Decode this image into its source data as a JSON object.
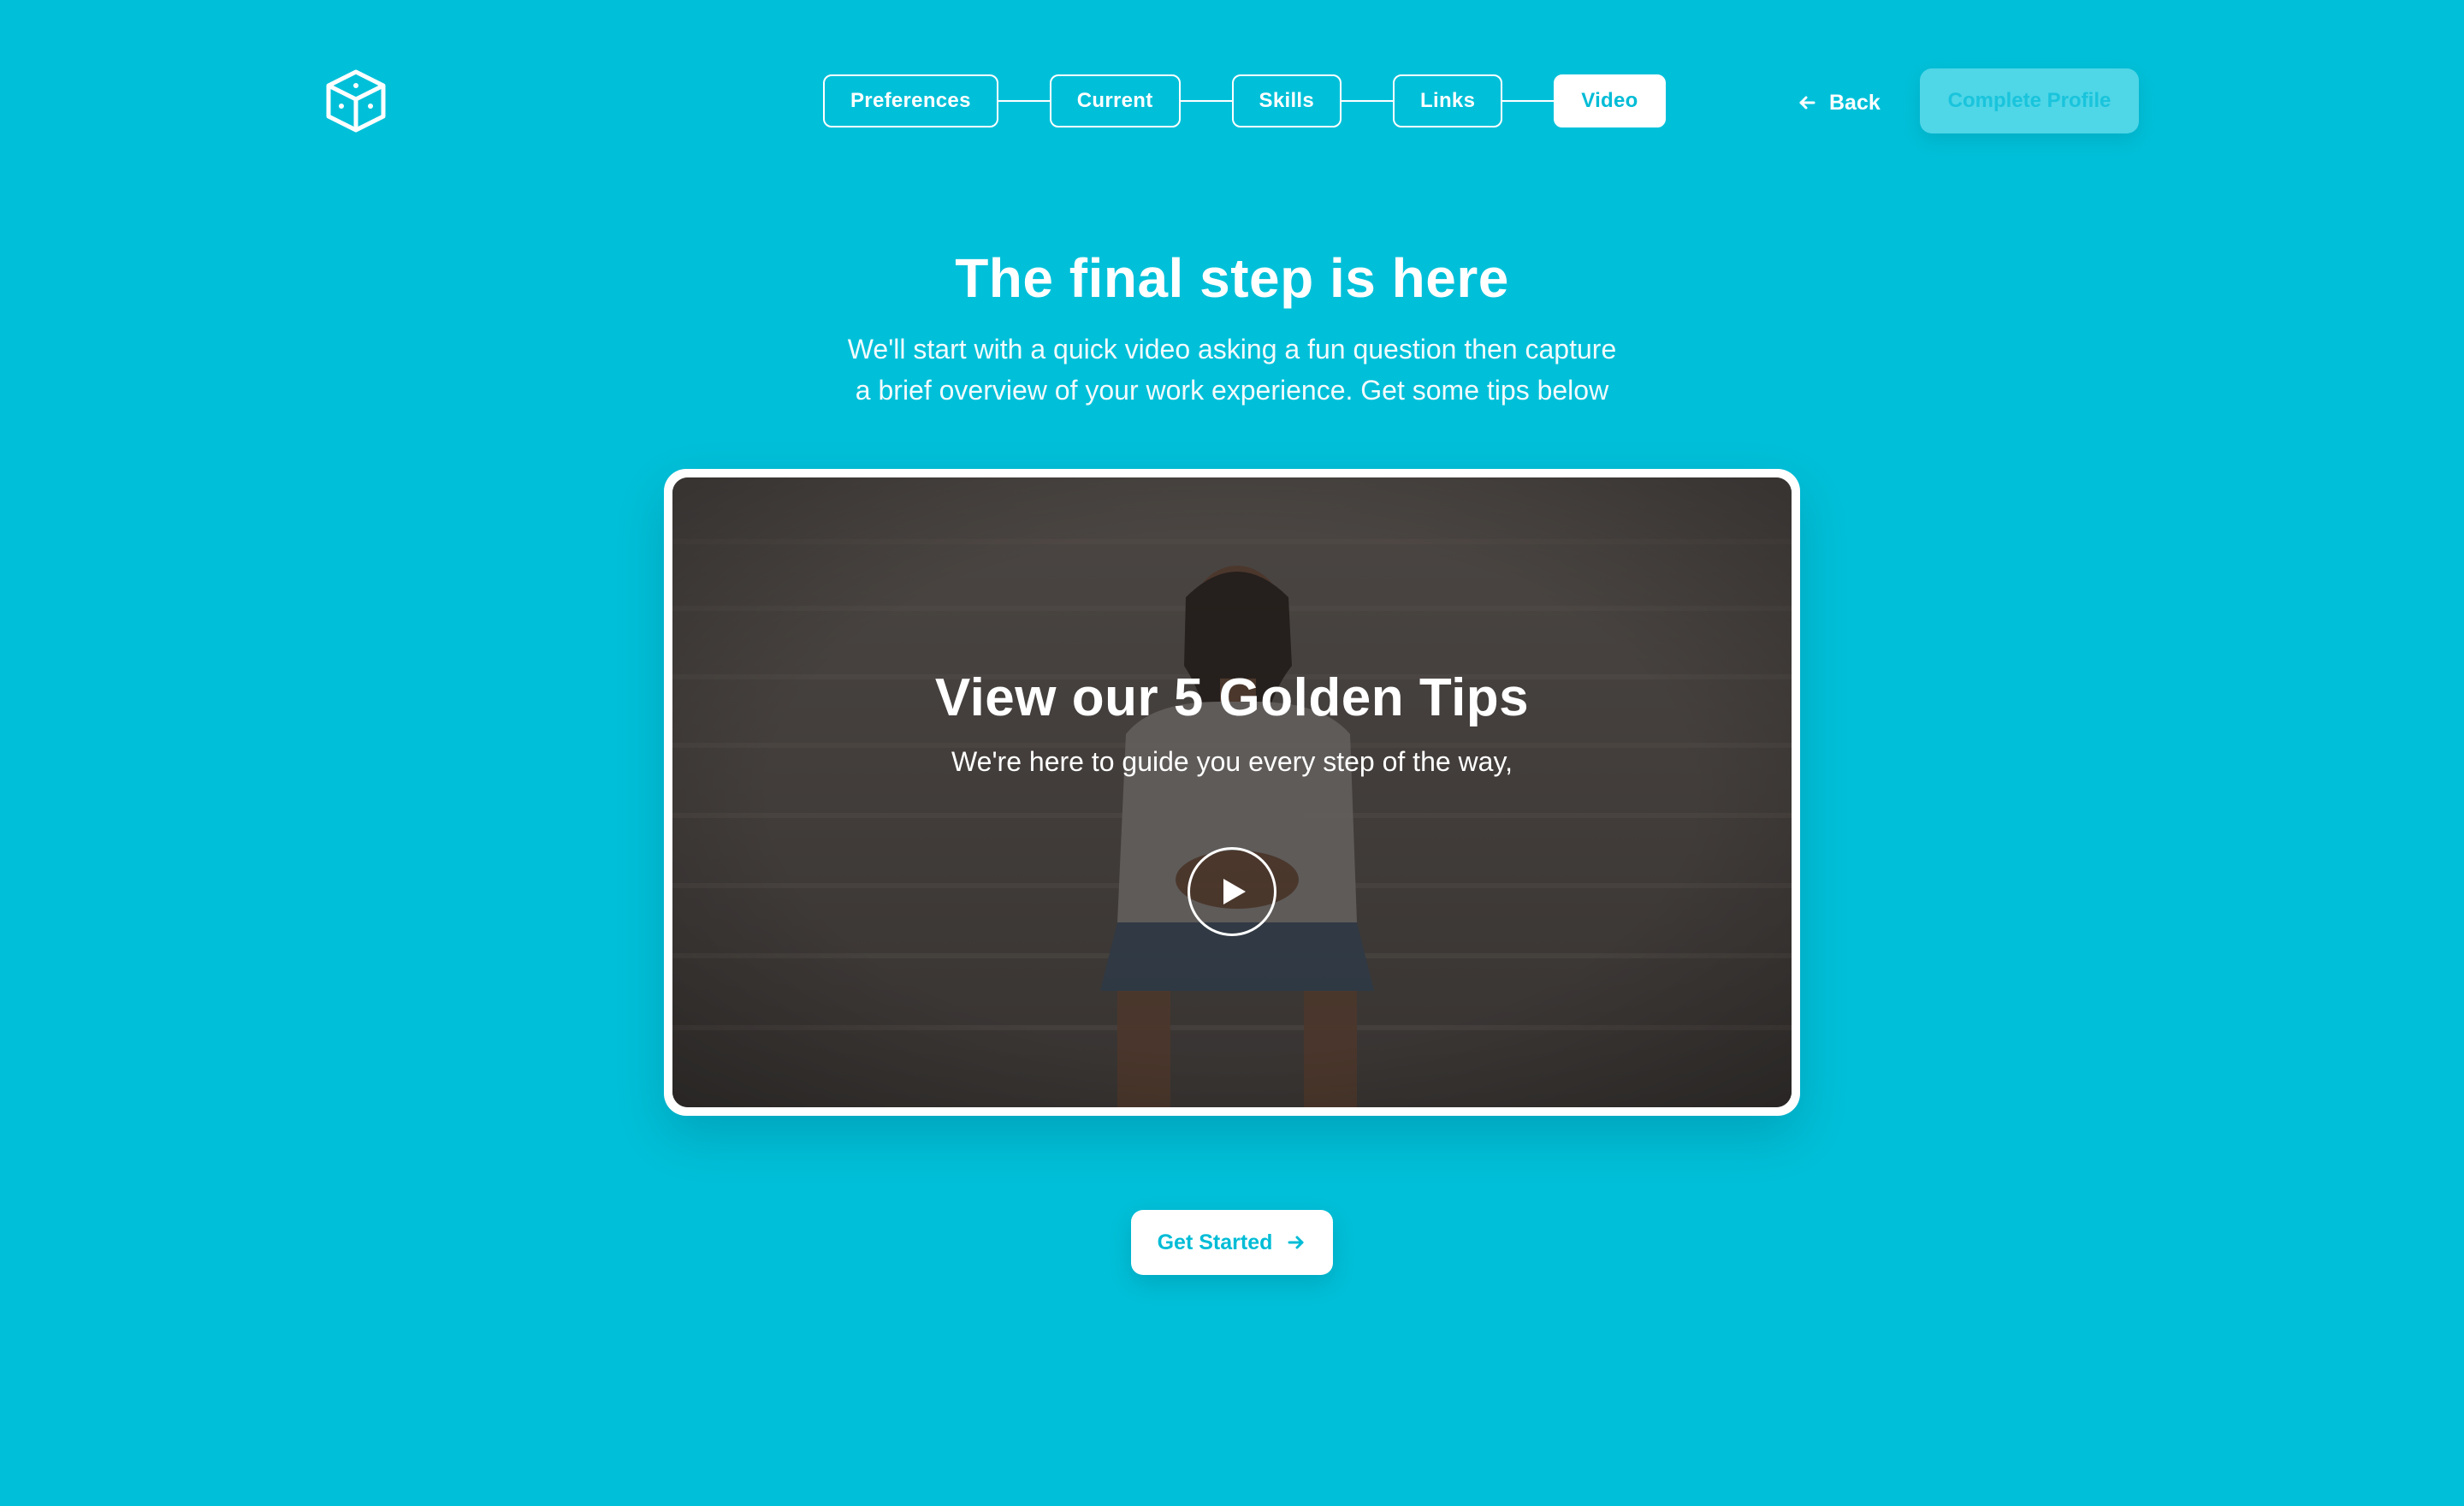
{
  "header": {
    "logo_icon": "cube-icon",
    "steps": [
      {
        "label": "Preferences",
        "active": false
      },
      {
        "label": "Current",
        "active": false
      },
      {
        "label": "Skills",
        "active": false
      },
      {
        "label": "Links",
        "active": false
      },
      {
        "label": "Video",
        "active": true
      }
    ],
    "back_label": "Back",
    "back_icon": "arrow-left-icon",
    "complete_label": "Complete Profile"
  },
  "main": {
    "title": "The final step is here",
    "subtitle_line1": "We'll start with a quick video asking a fun question then capture",
    "subtitle_line2": "a brief overview of your work experience. Get some tips below"
  },
  "video": {
    "title": "View our 5 Golden Tips",
    "subtitle": "We're here to guide you every step of the way,",
    "play_icon": "play-icon"
  },
  "cta": {
    "label": "Get Started",
    "icon": "arrow-right-icon"
  },
  "colors": {
    "background": "#00c0d9",
    "accent": "#00bcd6",
    "white": "#ffffff"
  }
}
